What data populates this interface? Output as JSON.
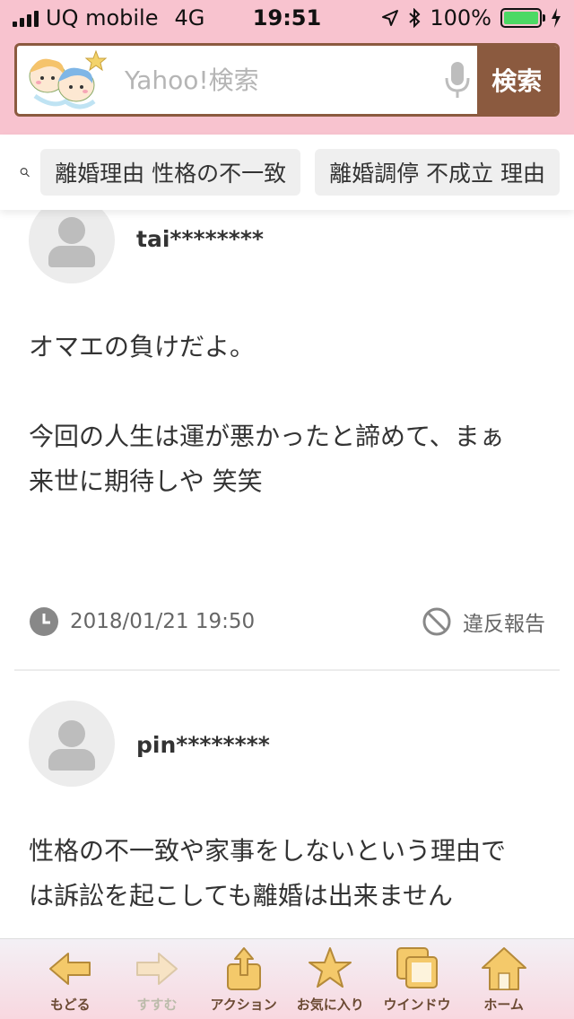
{
  "status_bar": {
    "carrier": "UQ mobile",
    "network": "4G",
    "time": "19:51",
    "battery": "100%",
    "battery_level": 1.0
  },
  "search": {
    "placeholder": "Yahoo!検索",
    "button_label": "検索",
    "mascot_icon": "twin-stars-mascot-icon",
    "mic_icon": "microphone-icon"
  },
  "suggestions": {
    "icon": "search-icon",
    "chips": [
      "離婚理由 性格の不一致",
      "離婚調停 不成立 理由"
    ]
  },
  "posts": [
    {
      "username": "tai********",
      "text_lines": [
        "オマエの負けだよ。",
        "",
        "今回の人生は運が悪かったと諦めて、まぁ",
        "来世に期待しや 笑笑"
      ],
      "timestamp": "2018/01/21 19:50",
      "report_label": "違反報告"
    },
    {
      "username": "pin********",
      "text_lines": [
        "性格の不一致や家事をしないという理由で",
        "は訴訟を起こしても離婚は出来ません"
      ]
    }
  ],
  "toolbar": {
    "items": [
      {
        "label": "もどる",
        "icon": "back-arrow-icon",
        "enabled": true
      },
      {
        "label": "すすむ",
        "icon": "forward-arrow-icon",
        "enabled": false
      },
      {
        "label": "アクション",
        "icon": "share-icon",
        "enabled": true
      },
      {
        "label": "お気に入り",
        "icon": "star-icon",
        "enabled": true
      },
      {
        "label": "ウインドウ",
        "icon": "windows-icon",
        "enabled": true
      },
      {
        "label": "ホーム",
        "icon": "home-icon",
        "enabled": true
      }
    ]
  },
  "colors": {
    "header_pink": "#f8c3cf",
    "search_brown": "#8b5a3f",
    "battery_green": "#4cd964"
  }
}
